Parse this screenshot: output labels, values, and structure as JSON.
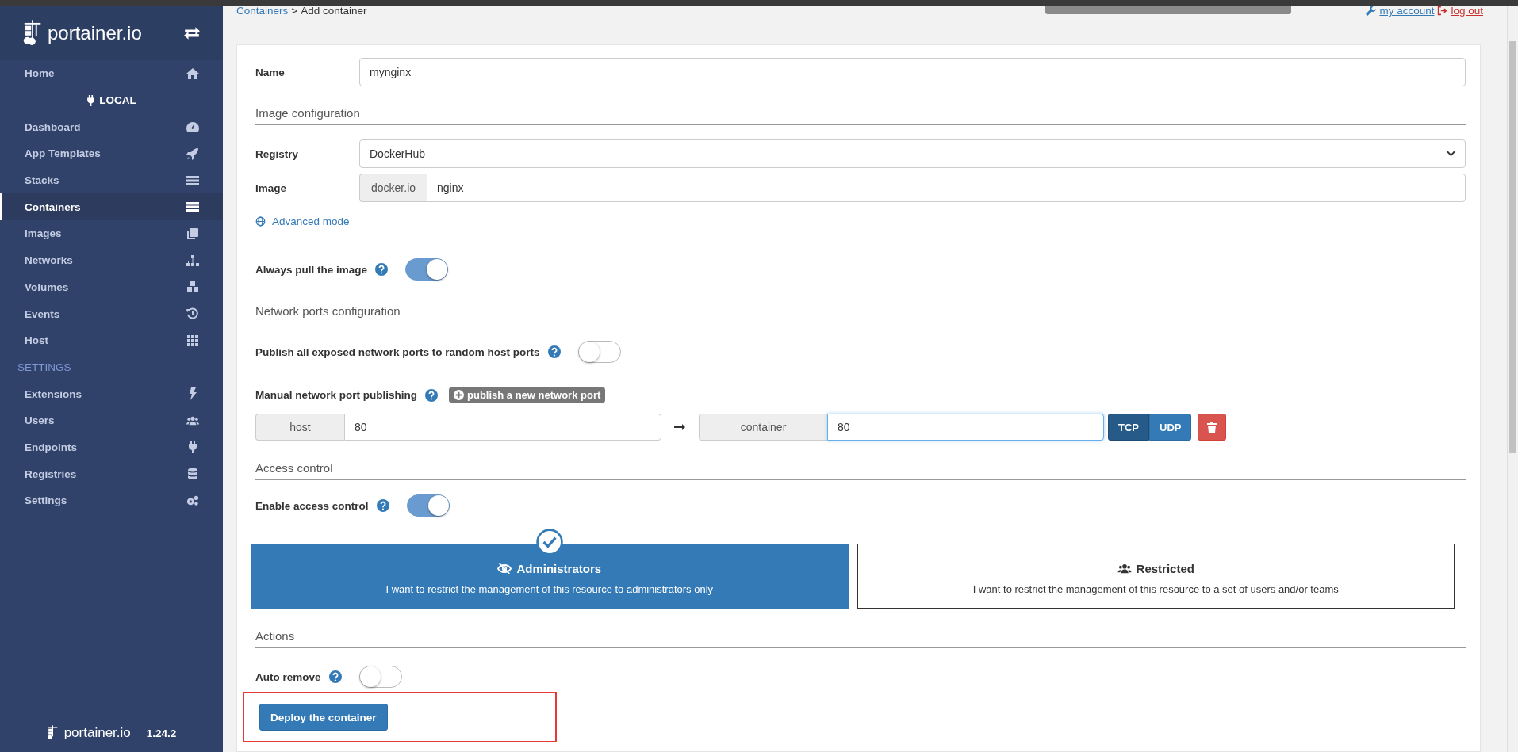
{
  "sidebar": {
    "brand": "portainer.io",
    "home": {
      "label": "Home",
      "selected": false
    },
    "endpoint": "LOCAL",
    "items": [
      {
        "label": "Dashboard",
        "selected": false
      },
      {
        "label": "App Templates",
        "selected": false
      },
      {
        "label": "Stacks",
        "selected": false
      },
      {
        "label": "Containers",
        "selected": true
      },
      {
        "label": "Images",
        "selected": false
      },
      {
        "label": "Networks",
        "selected": false
      },
      {
        "label": "Volumes",
        "selected": false
      },
      {
        "label": "Events",
        "selected": false
      },
      {
        "label": "Host",
        "selected": false
      }
    ],
    "section": "SETTINGS",
    "settings_items": [
      {
        "label": "Extensions",
        "selected": false
      },
      {
        "label": "Users",
        "selected": false
      },
      {
        "label": "Endpoints",
        "selected": false
      },
      {
        "label": "Registries",
        "selected": false
      },
      {
        "label": "Settings",
        "selected": false
      }
    ],
    "footer": {
      "brand": "portainer.io",
      "version": "1.24.2"
    }
  },
  "header": {
    "breadcrumb_link": "Containers",
    "breadcrumb_separator": ">",
    "breadcrumb_current": "Add container",
    "account_link": "my account",
    "logout_link": "log out"
  },
  "form": {
    "name": {
      "label": "Name",
      "value": "mynginx"
    },
    "image_configuration": {
      "title": "Image configuration",
      "registry": {
        "label": "Registry",
        "value": "DockerHub"
      },
      "image": {
        "label": "Image",
        "prefix": "docker.io",
        "value": "nginx"
      },
      "advanced_link": "Advanced mode",
      "always_pull": {
        "label": "Always pull the image",
        "on": true
      }
    },
    "network": {
      "title": "Network ports configuration",
      "publish_all": {
        "label": "Publish all exposed network ports to random host ports",
        "on": false
      },
      "manual_label": "Manual network port publishing",
      "add_button": "publish a new network port",
      "ports": [
        {
          "host_label": "host",
          "host": "80",
          "container_label": "container",
          "container": "80",
          "protocols": [
            {
              "label": "TCP",
              "selected": true
            },
            {
              "label": "UDP",
              "selected": false
            }
          ]
        }
      ]
    },
    "access": {
      "title": "Access control",
      "enable": {
        "label": "Enable access control",
        "on": true
      },
      "options": [
        {
          "title": "Administrators",
          "description": "I want to restrict the management of this resource to administrators only",
          "selected": true
        },
        {
          "title": "Restricted",
          "description": "I want to restrict the management of this resource to a set of users and/or teams",
          "selected": false
        }
      ]
    },
    "actions": {
      "title": "Actions",
      "auto_remove": {
        "label": "Auto remove",
        "on": false
      },
      "deploy_button": "Deploy the container"
    }
  }
}
